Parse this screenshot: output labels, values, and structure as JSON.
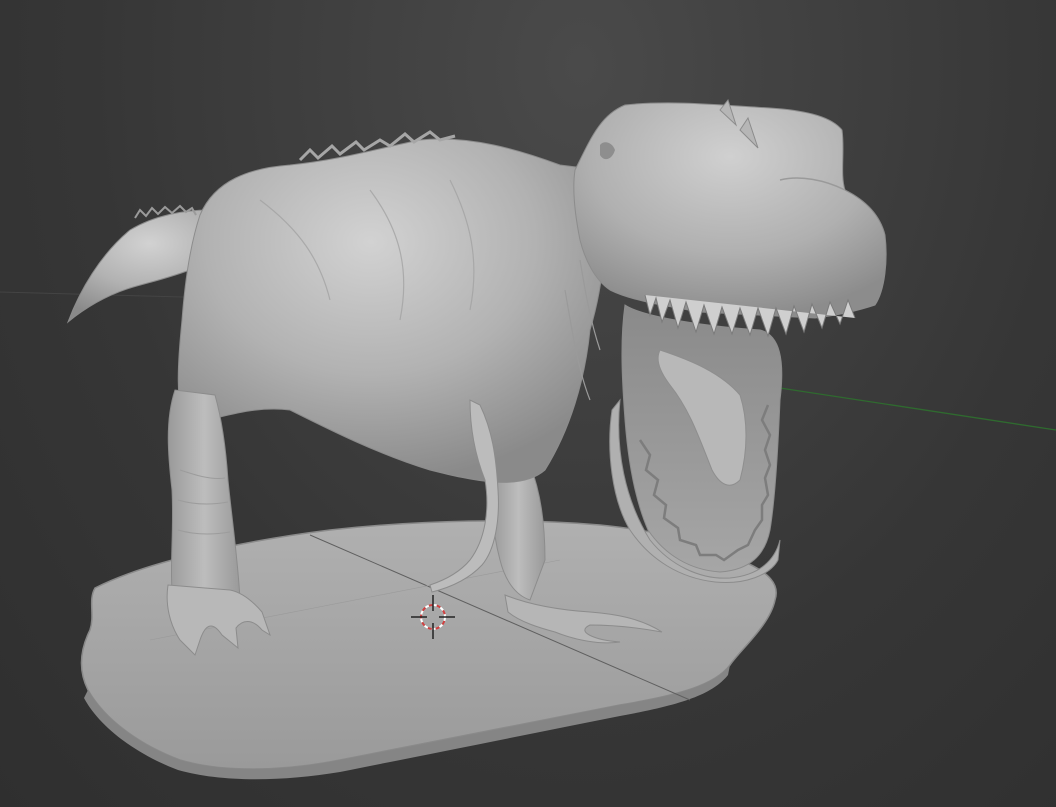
{
  "viewport": {
    "background_color": "#3a3a3a",
    "grid_line_color": "#555555",
    "x_axis_color": "#9a4a4a",
    "y_axis_color": "#3f8a3f",
    "model_color": "#b4b4b4",
    "base_color": "#a8a8a8",
    "cursor_color": "#e0e0e0",
    "cursor_ring_color": "#d04040"
  },
  "scene": {
    "objects": [
      {
        "name": "trex-model",
        "icon": "sculpt-mesh"
      },
      {
        "name": "base-plate",
        "icon": "mesh-plane"
      }
    ],
    "cursor_icon": "3d-cursor-icon"
  }
}
